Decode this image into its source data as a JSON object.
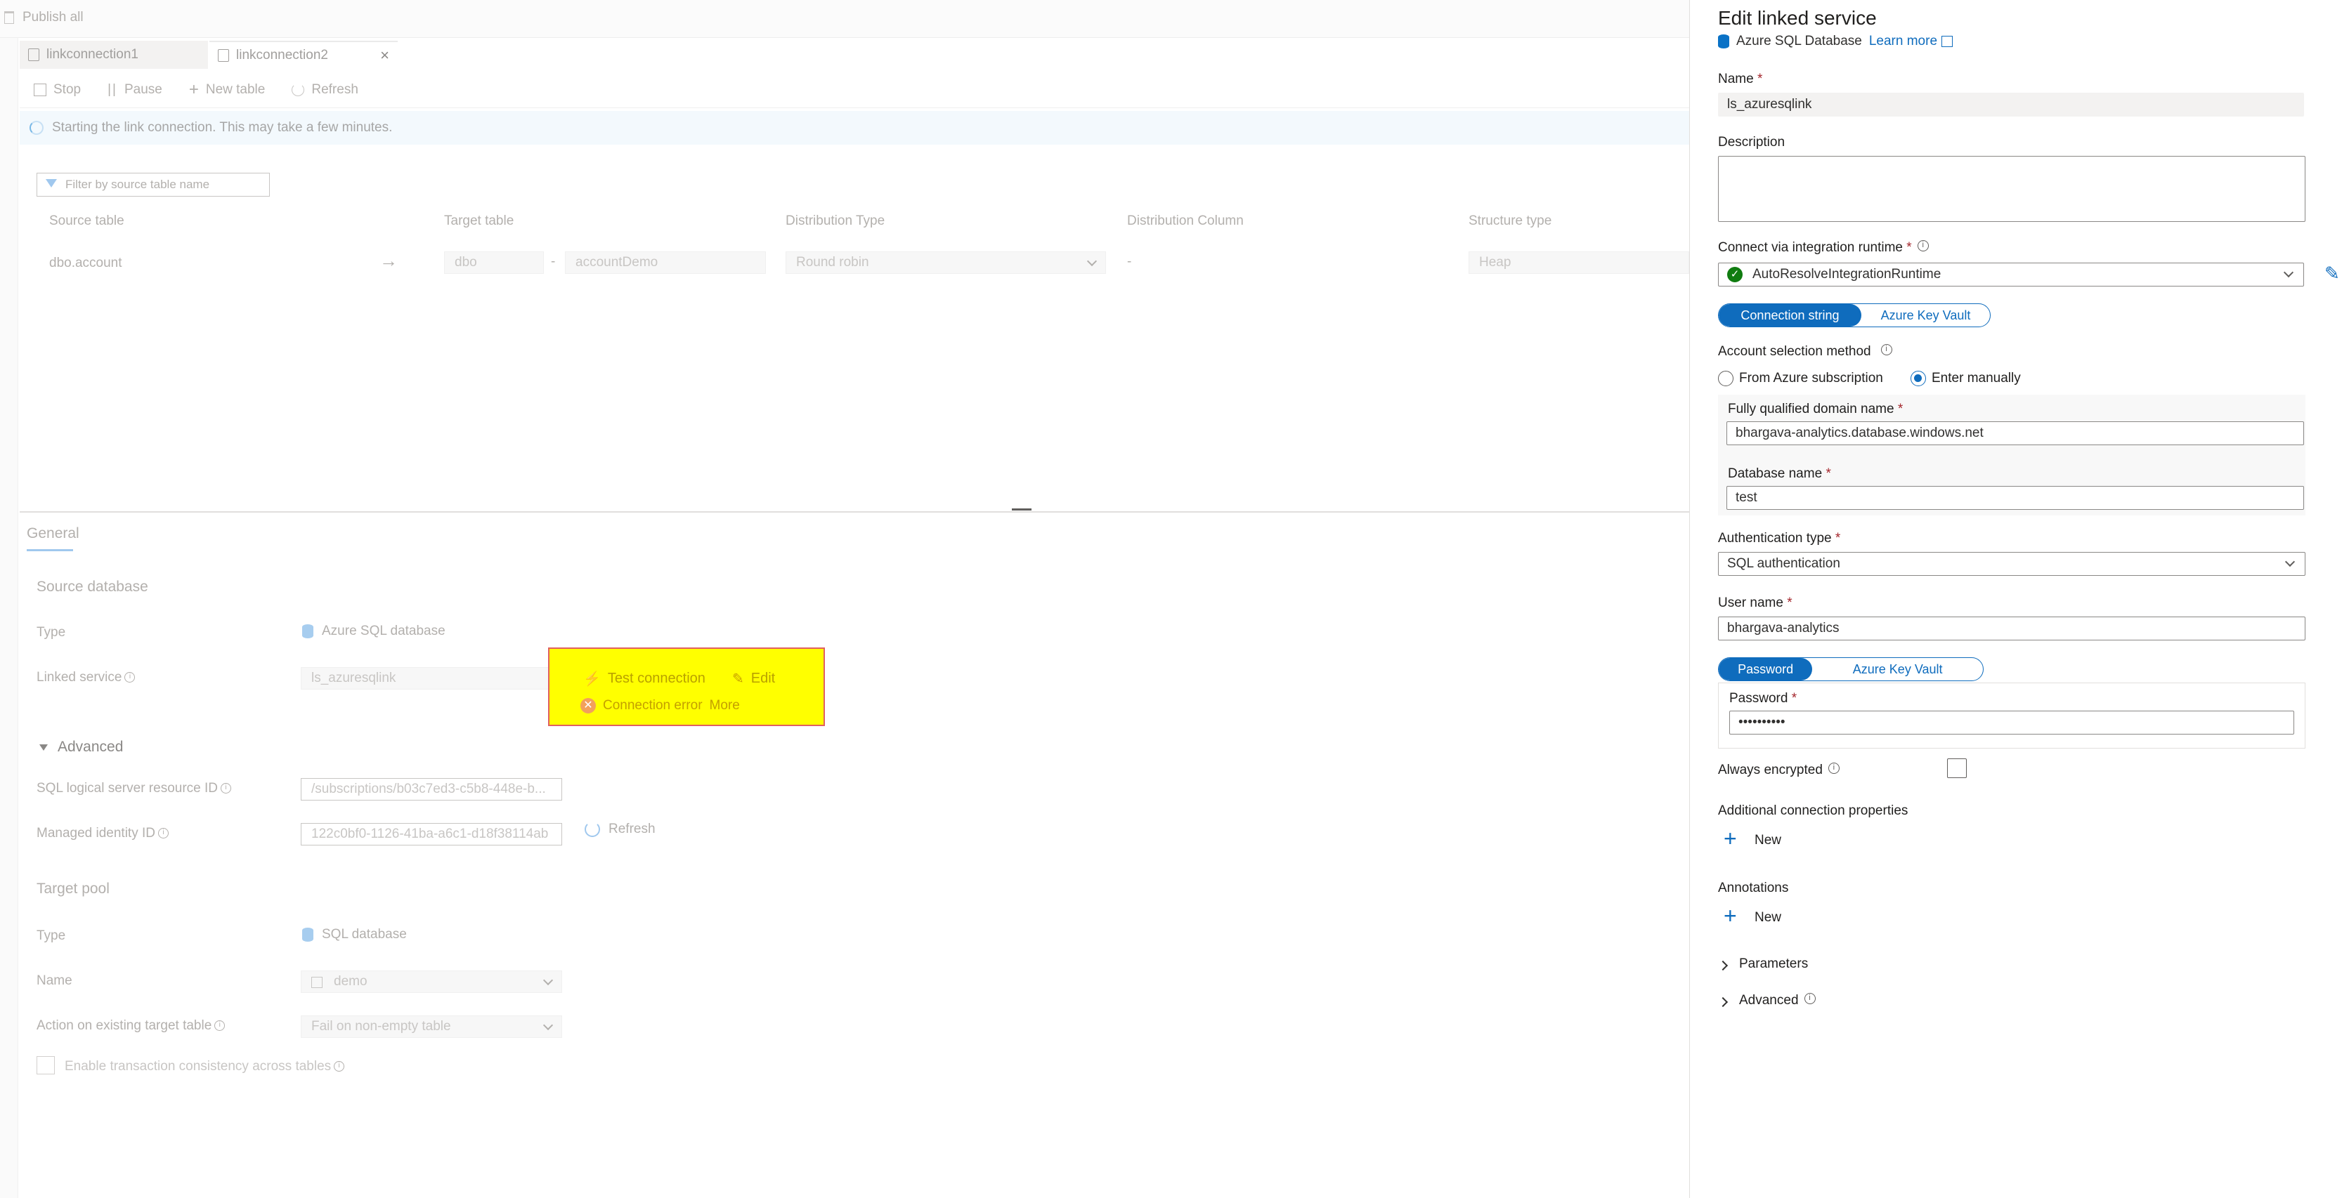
{
  "top": {
    "publish_all": "Publish all"
  },
  "tabs": [
    {
      "label": "linkconnection1"
    },
    {
      "label": "linkconnection2"
    }
  ],
  "toolbar": {
    "stop": "Stop",
    "pause": "Pause",
    "new_table": "New table",
    "refresh": "Refresh"
  },
  "info_bar": {
    "text": "Starting the link connection. This may take a few minutes."
  },
  "filter": {
    "placeholder": "Filter by source table name"
  },
  "table": {
    "headers": [
      "Source table",
      "Target table",
      "Distribution Type",
      "Distribution Column",
      "Structure type"
    ],
    "row": {
      "source": "dbo.account",
      "target_schema": "dbo",
      "separator": "-",
      "target_table": "accountDemo",
      "distribution_type": "Round robin",
      "distribution_column": "-",
      "structure_type": "Heap"
    }
  },
  "general": {
    "tab_label": "General",
    "source_database": "Source database",
    "type_label": "Type",
    "type_value": "Azure SQL database",
    "linked_service_label": "Linked service",
    "linked_service_value": "ls_azuresqlink",
    "test_connection": "Test connection",
    "edit": "Edit",
    "connection_error": "Connection error",
    "more": "More",
    "advanced": "Advanced",
    "sql_resource_label": "SQL logical server resource ID",
    "sql_resource_value": "/subscriptions/b03c7ed3-c5b8-448e-b...",
    "managed_identity_label": "Managed identity ID",
    "managed_identity_value": "122c0bf0-1126-41ba-a6c1-d18f38114ab",
    "refresh": "Refresh",
    "target_pool": "Target pool",
    "target_type_label": "Type",
    "target_type_value": "SQL database",
    "name_label": "Name",
    "name_value": "demo",
    "action_label": "Action on existing target table",
    "action_value": "Fail on non-empty table",
    "transaction_label": "Enable transaction consistency across tables"
  },
  "panel": {
    "title": "Edit linked service",
    "service_type": "Azure SQL Database",
    "learn_more": "Learn more",
    "name_label": "Name",
    "name_value": "ls_azuresqlink",
    "description_label": "Description",
    "runtime_label": "Connect via integration runtime",
    "runtime_value": "AutoResolveIntegrationRuntime",
    "conn_tab_on": "Connection string",
    "conn_tab_off": "Azure Key Vault",
    "account_method_label": "Account selection method",
    "account_option_1": "From Azure subscription",
    "account_option_2": "Enter manually",
    "fqdn_label": "Fully qualified domain name",
    "fqdn_value": "bhargava-analytics.database.windows.net",
    "db_label": "Database name",
    "db_value": "test",
    "auth_label": "Authentication type",
    "auth_value": "SQL authentication",
    "user_label": "User name",
    "user_value": "bhargava-analytics",
    "pw_tab_on": "Password",
    "pw_tab_off": "Azure Key Vault",
    "password_label": "Password",
    "password_value": "••••••••••",
    "always_encrypted": "Always encrypted",
    "additional_props": "Additional connection properties",
    "new_1": "New",
    "annotations": "Annotations",
    "new_2": "New",
    "parameters": "Parameters",
    "advanced": "Advanced"
  },
  "colors": {
    "accent": "#0f6cbd",
    "highlight": "#ffff00",
    "success": "#107c10"
  }
}
